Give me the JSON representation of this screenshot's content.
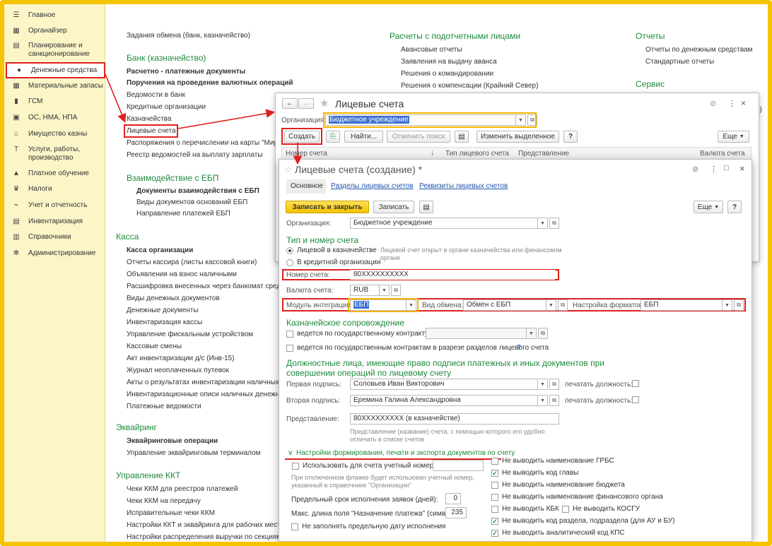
{
  "sidebar": {
    "items": [
      {
        "label": "Главное",
        "icon": "menu-icon"
      },
      {
        "label": "Органайзер",
        "icon": "calendar-icon"
      },
      {
        "label": "Планирование и санкционирование",
        "icon": "plan-icon"
      },
      {
        "label": "Денежные средства",
        "icon": "money-icon"
      },
      {
        "label": "Материальные запасы",
        "icon": "grid-icon"
      },
      {
        "label": "ГСМ",
        "icon": "fuel-icon"
      },
      {
        "label": "ОС, НМА, НПА",
        "icon": "asset-icon"
      },
      {
        "label": "Имущество казны",
        "icon": "building-icon"
      },
      {
        "label": "Услуги, работы, производство",
        "icon": "tools-icon"
      },
      {
        "label": "Платное обучение",
        "icon": "education-icon"
      },
      {
        "label": "Налоги",
        "icon": "eagle-icon"
      },
      {
        "label": "Учет и отчетность",
        "icon": "chart-icon"
      },
      {
        "label": "Инвентаризация",
        "icon": "inventory-icon"
      },
      {
        "label": "Справочники",
        "icon": "book-icon"
      },
      {
        "label": "Администрирование",
        "icon": "gear-icon"
      }
    ]
  },
  "main": {
    "col1": {
      "top_link": "Задания обмена (банк, казначейство)",
      "bank_title": "Банк (казначейство)",
      "bank_items": [
        "Расчетно - платежные документы",
        "Поручения на проведение валютных операций",
        "Ведомости в банк",
        "Кредитные организации",
        "Казначейства",
        "Лицевые счета",
        "Распоряжения о перечислении на карты \"Мир\"",
        "Реестр ведомостей на выплату зарплаты"
      ],
      "ebp_title": "Взаимодействие с ЕБП",
      "ebp_items": [
        "Документы взаимодействия с ЕБП",
        "Виды документов оснований ЕБП",
        "Направление платежей ЕБП"
      ],
      "kassa_title": "Касса",
      "kassa_items": [
        "Касса организации",
        "Отчеты кассира (листы кассовой книги)",
        "Объявления на взнос наличными",
        "Расшифровка внесенных через банкомат сред",
        "Виды денежных документов",
        "Денежные документы",
        "Инвентаризация кассы",
        "Управление фискальным устройством",
        "Кассовые смены",
        "Акт инвентаризации д/с (Инв-15)",
        "Журнал неоплаченных путевок",
        "Акты о результатах инвентаризации наличных д",
        "Инвентаризационные описи наличных денежн",
        "Платежные ведомости"
      ],
      "acq_title": "Эквайринг",
      "acq_items": [
        "Эквайринговые операции",
        "Управление эквайринговым терминалом"
      ],
      "kkt_title": "Управление ККТ",
      "kkt_items": [
        "Чеки ККМ для реестров платежей",
        "Чеки ККМ на передачу",
        "Исправительные чеки ККМ",
        "Настройки ККТ и эквайринга для рабочих мест",
        "Настройки распределения выручки по секциям ККТ"
      ]
    },
    "col2": {
      "title": "Расчеты с подотчетными лицами",
      "items": [
        "Авансовые отчеты",
        "Заявления на выдачу аванса",
        "Решения о командировании",
        "Решения о компенсации (Крайний Север)"
      ]
    },
    "col3": {
      "title": "Отчеты",
      "items": [
        "Отчеты по денежным средствам",
        "Стандартные отчеты"
      ],
      "service_title": "Сервис",
      "clip": "тво)"
    }
  },
  "win1": {
    "title": "Лицевые счета",
    "org_label": "Организация:",
    "org_value": "Бюджетное учреждение",
    "create": "Создать",
    "find": "Найти...",
    "cancel_search": "Отменить поиск",
    "change_selected": "Изменить выделенное",
    "help": "?",
    "more": "Еще",
    "columns": [
      "Номер счета",
      "Тип лицевого счета",
      "Представление",
      "Валюта счета"
    ]
  },
  "win2": {
    "title": "Лицевые счета (создание) *",
    "tabs": [
      "Основное",
      "Разделы лицевых счетов",
      "Реквизиты лицевых счетов"
    ],
    "save_close": "Записать и закрыть",
    "save": "Записать",
    "more": "Еще",
    "help": "?",
    "org_label": "Организация:",
    "org_value": "Бюджетное учреждение",
    "type_section": "Тип и номер счета",
    "radio1": "Лицевой в казначействе",
    "radio2": "В кредитной организации",
    "radio_hint": "Лицевой счет открыт в органе казначейства или финансовом органе",
    "num_label": "Номер счета:",
    "num_value": "80XXXXXXXXXX",
    "currency_label": "Валюта счета:",
    "currency_value": "RUB",
    "integ_label": "Модуль интеграции:",
    "integ_value": "ЕБП",
    "exch_label": "Вид обмена:",
    "exch_value": "Обмен с ЕБП",
    "format_label": "Настройка форматов:",
    "format_value": "ЕБП",
    "treasury_section": "Казначейское сопровождение",
    "treasury_chk1": "ведется по государственному контракту:",
    "treasury_chk2": "ведется по государственным контрактам в разрезе разделов лицевого счета",
    "treasury_q": "?",
    "sign_section": "Должностные лица, имеющие право подписи платежных и иных документов при совершении операций по лицевому счету",
    "sign1_label": "Первая подпись:",
    "sign1_value": "Соловьев Иван Викторович",
    "sign2_label": "Вторая подпись:",
    "sign2_value": "Еремина Галина Александровна",
    "print_pos": "печатать должность:",
    "repr_label": "Представление:",
    "repr_value": "80XXXXXXXXX (в казначействе)",
    "repr_hint": "Представление (название) счета, с помощью которого его удобно отличать в списке счетов",
    "settings_link": "Настройки формирования, печати и экспорта документов по счету",
    "use_acc_num": "Использовать для счета учетный номер:",
    "use_acc_hint": "При отключенном флажке будет использован учетный номер, указанный в справочнике \"Организации\"",
    "deadline_label": "Предельный срок исполнения заявок (дней):",
    "deadline_value": "0",
    "maxlen_label": "Макс. длина поля \"Назначение платежа\" (симв.):",
    "maxlen_value": "235",
    "no_fill_date": "Не заполнять предельную дату исполнения",
    "right_checks": [
      {
        "label": "Не выводить наименование ГРБС",
        "checked": false
      },
      {
        "label": "Не выводить код главы",
        "checked": true
      },
      {
        "label": "Не выводить наименование бюджета",
        "checked": false
      },
      {
        "label": "Не выводить наименование финансового органа",
        "checked": false
      },
      {
        "label": "Не выводить КБК",
        "checked": false
      },
      {
        "label": "Не выводить код раздела, подраздела (для АУ и БУ)",
        "checked": true
      },
      {
        "label": "Не выводить аналитический код КПС",
        "checked": true
      }
    ],
    "kosgu": "Не выводить КОСГУ"
  }
}
